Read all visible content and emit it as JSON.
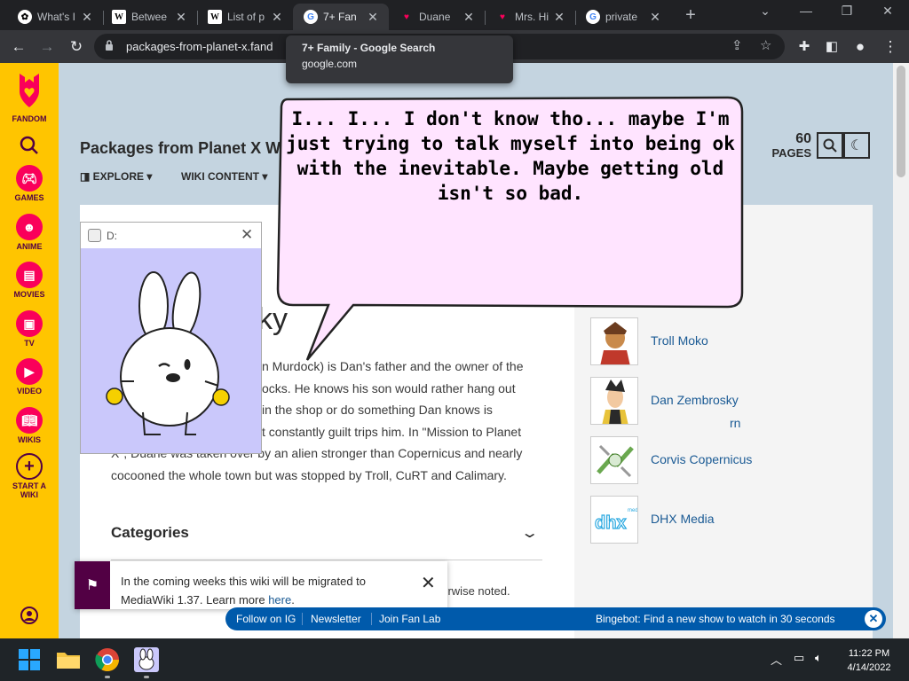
{
  "tabs": [
    {
      "label": "What's I",
      "favicon": "chatgpt-icon"
    },
    {
      "label": "Betwee",
      "favicon": "wikipedia-icon"
    },
    {
      "label": "List of p",
      "favicon": "wikipedia-icon"
    },
    {
      "label": "7+ Fan",
      "favicon": "google-icon",
      "active": true
    },
    {
      "label": "Duane",
      "favicon": "fandom-icon"
    },
    {
      "label": "Mrs. Hi",
      "favicon": "fandom-icon"
    },
    {
      "label": "private",
      "favicon": "google-icon"
    }
  ],
  "tooltip": {
    "title": "7+ Family - Google Search",
    "domain": "google.com"
  },
  "address_bar": {
    "url": "packages-from-planet-x.fand"
  },
  "fandom_rail": {
    "brand": "FANDOM",
    "items": [
      "GAMES",
      "ANIME",
      "MOVIES",
      "TV",
      "VIDEO",
      "WIKIS"
    ],
    "start_wiki": [
      "START A",
      "WIKI"
    ]
  },
  "wiki": {
    "title": "Packages from Planet X W",
    "nav": [
      "EXPLORE",
      "WIKI CONTENT"
    ],
    "page_count": "60",
    "page_count_label": "PAGES"
  },
  "article": {
    "title_fragment": "ky",
    "lines": [
      "n Murdock) is Dan's father and the owner of the",
      "ocks. He knows his son would rather hang out",
      "in the shop or do something Dan knows is",
      "t constantly guilt trips him. In \"Mission to Planet",
      "X\", Duane was taken over by an alien stronger than Copernicus and nearly",
      "cocooned the whole town but was stopped by Troll, CuRT and Calimary."
    ],
    "categories_heading": "Categories",
    "license_fragment": "herwise noted."
  },
  "related": [
    {
      "name": "rn"
    },
    {
      "name": "Troll Moko"
    },
    {
      "name": "Dan Zembrosky"
    },
    {
      "name": "Corvis Copernicus"
    },
    {
      "name": "DHX Media"
    }
  ],
  "notice": {
    "text": "In the coming weeks this wiki will be migrated to MediaWiki 1.37. Learn more",
    "link": "here",
    "end": "."
  },
  "fanbar": {
    "links": [
      "Follow on IG",
      "Newsletter",
      "Join Fan Lab"
    ],
    "promo": "Bingebot: Find a new show to watch in 30 seconds"
  },
  "pet_window": {
    "title": "D:"
  },
  "speech_bubble": {
    "lines": [
      "I... I... I don't know tho... maybe I'm",
      "just trying to talk myself into being ok",
      "with the inevitable. Maybe getting old",
      "isn't so bad."
    ]
  },
  "taskbar": {
    "time": "11:22 PM",
    "date": "4/14/2022"
  },
  "colors": {
    "fandom_yellow": "#ffc500",
    "fandom_pink": "#fa005a",
    "bubble_fill": "#ffe4ff",
    "fanbar_blue": "#005aab"
  }
}
